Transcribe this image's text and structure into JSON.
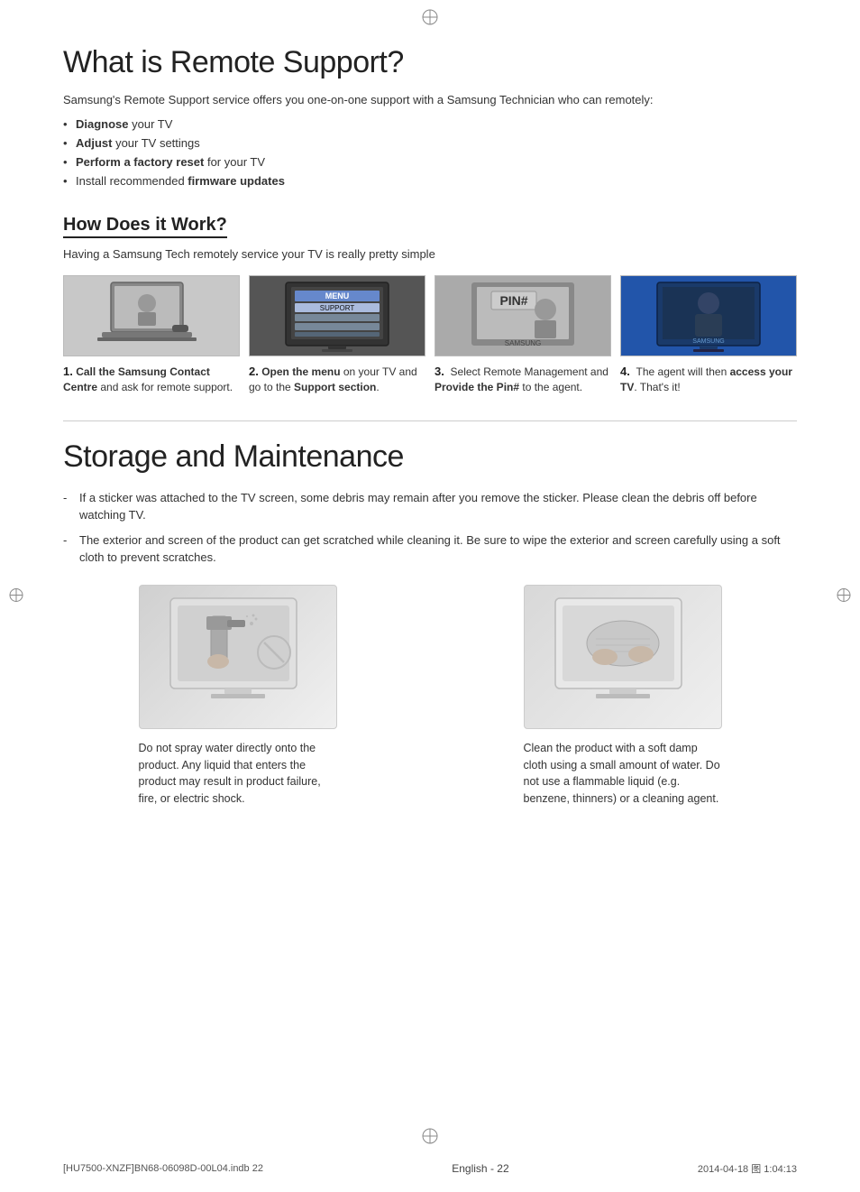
{
  "page": {
    "title": "What is Remote Support?",
    "intro": "Samsung's Remote Support service offers you one-on-one support with a Samsung Technician who can remotely:",
    "bullets": [
      {
        "bold": "Diagnose",
        "rest": " your TV"
      },
      {
        "bold": "Adjust",
        "rest": " your TV settings"
      },
      {
        "bold": "Perform a factory reset",
        "rest": " for your TV"
      },
      {
        "plain_start": "Install recommended ",
        "bold": "firmware updates",
        "plain_end": ""
      }
    ],
    "how_section": {
      "title": "How Does it Work?",
      "desc": "Having a Samsung Tech remotely service your TV is really pretty simple",
      "steps": [
        {
          "num": "1.",
          "label": "Call the Samsung Contact Centre",
          "rest": " and ask for remote support.",
          "bold_label": "Call the Samsung Contact Centre"
        },
        {
          "num": "2.",
          "prefix": "Open the menu on",
          "middle": " your TV and go to the ",
          "bold": "Support section",
          "suffix": ".",
          "open_bold": "Open the menu"
        },
        {
          "num": "3.",
          "text_parts": [
            {
              "plain": "Select Remote Management and "
            },
            {
              "bold": "Provide the Pin#"
            },
            {
              "plain": " to the agent."
            }
          ]
        },
        {
          "num": "4.",
          "text_parts": [
            {
              "plain": "The agent will then "
            },
            {
              "bold": "access your TV"
            },
            {
              "plain": ". That's it!"
            }
          ]
        }
      ]
    },
    "storage_section": {
      "title": "Storage and Maintenance",
      "bullets": [
        "If a sticker was attached to the TV screen, some debris may remain after you remove the sticker. Please clean the debris off before watching TV.",
        "The exterior and screen of the product can get scratched while cleaning it. Be sure to wipe the exterior and screen carefully using a soft cloth to prevent scratches."
      ],
      "images": [
        {
          "type": "spray",
          "caption": "Do not spray water directly onto the product. Any liquid that enters the product may result in product failure, fire, or electric shock."
        },
        {
          "type": "cloth",
          "caption": "Clean the product with a soft damp cloth using a small amount of water. Do not use a flammable liquid (e.g. benzene, thinners) or a cleaning agent."
        }
      ]
    },
    "footer": {
      "left": "[HU7500-XNZF]BN68-06098D-00L04.indb   22",
      "center": "English - 22",
      "right": "2014-04-18   图 1:04:13"
    }
  }
}
